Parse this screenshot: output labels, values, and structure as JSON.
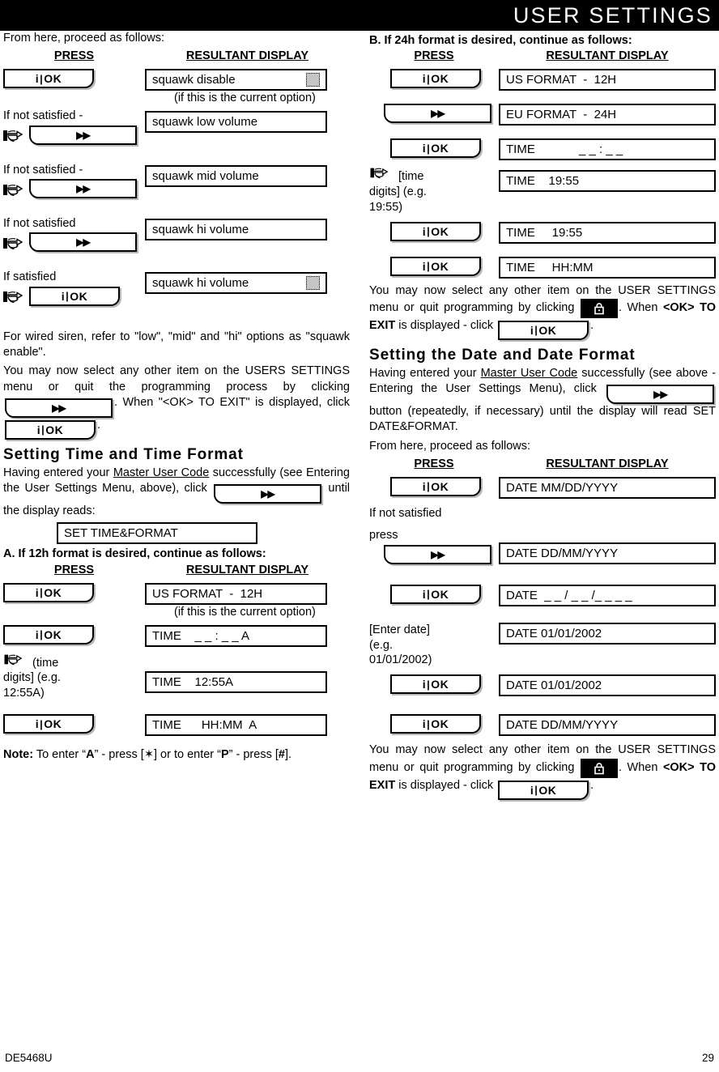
{
  "banner": {
    "title": "USER SETTINGS"
  },
  "keys": {
    "ok_label": "OK",
    "ok_i": "i",
    "ok_sep": "|",
    "next_label": "▶▶",
    "lock_name": "away-arm-lock-button"
  },
  "columns": {
    "press_header": "PRESS",
    "result_header": "RESULTANT DISPLAY"
  },
  "left": {
    "intro": "From here, proceed as follows:",
    "steps": [
      {
        "display": "squawk disable",
        "cursor": true,
        "sub": "(if this is the current option)"
      },
      {
        "label": "If not satisfied -",
        "display": "squawk low volume"
      },
      {
        "label": "If not satisfied -",
        "display": "squawk mid volume"
      },
      {
        "label": "If not satisfied",
        "display": "squawk hi volume"
      },
      {
        "label": "If satisfied",
        "display": "squawk hi volume",
        "cursor": true
      }
    ],
    "para_wired_1": "For wired siren, refer to \"low\", \"mid\" and \"hi\" options",
    "para_wired_2": "as \"squawk enable\".",
    "para_quit_1": "You may now select any other item on the USERS",
    "para_quit_2": "SETTINGS menu or quit the programming process by",
    "para_quit_3a": "clicking",
    "para_quit_3b": ". When \"<OK> TO EXIT\" is",
    "para_quit_4a": "displayed, click",
    "para_quit_4b": ".",
    "heading_time": "Setting Time and Time Format",
    "time_para_1": "Having entered your",
    "time_para_1_link": "Master User Code",
    "time_para_1_end": "successfully",
    "time_para_2": "(see Entering the User Settings Menu, above), click",
    "time_para_3": "until the display reads:",
    "set_time_display": "SET TIME&FORMAT",
    "subhead_a": "A. If 12h format is desired, continue as follows:",
    "steps_a": [
      {
        "display": "US FORMAT  -  12H",
        "sub": "(if this is the current option)"
      },
      {
        "display": "TIME    _ _ : _ _ A"
      },
      {
        "hand": true,
        "label_lines": [
          "(time",
          "digits] (e.g.",
          "12:55A)"
        ],
        "display": "TIME    12:55A"
      },
      {
        "display": "TIME      HH:MM  A"
      }
    ],
    "note_prefix": "Note:",
    "note_text_1": " To enter “",
    "note_a": "A",
    "note_text_2": "” - press [",
    "note_star": "✶",
    "note_text_3": "] or to enter “",
    "note_p": "P",
    "note_text_4": "” - press [",
    "note_hash": "#",
    "note_text_5": "]."
  },
  "right": {
    "subhead_b": "B. If 24h format is desired, continue as follows:",
    "steps_b": [
      {
        "key": "ok",
        "display": "US FORMAT  -  12H"
      },
      {
        "key": "next",
        "display": "EU FORMAT  -  24H"
      },
      {
        "key": "ok",
        "display": "TIME             _ _ : _ _"
      },
      {
        "hand": true,
        "label_lines": [
          "[time",
          "digits] (e.g.",
          "19:55)"
        ],
        "display": "TIME    19:55"
      },
      {
        "key": "ok",
        "display": "TIME     19:55"
      },
      {
        "key": "ok",
        "display": "TIME     HH:MM"
      }
    ],
    "quit_1": "You may now select any other item on the USER",
    "quit_2": "SETTINGS menu or quit programming by clicking",
    "quit_3b": ". When",
    "quit_ok_tag": "<OK>",
    "quit_exit": "TO EXIT",
    "quit_3c": "is displayed - click",
    "quit_4b": ".",
    "heading_date": "Setting the Date and Date Format",
    "date_para_1": "Having entered your",
    "date_para_1_link": "Master User Code",
    "date_para_1_end": "successfully",
    "date_para_2": "(see above - Entering the User Settings Menu),  click",
    "date_para_3": "button (repeatedly, if necessary) until",
    "date_para_4": "the display will read SET DATE&FORMAT.",
    "date_para_5": "From here, proceed as follows:",
    "steps_d": [
      {
        "key": "ok",
        "display": "DATE MM/DD/YYYY"
      },
      {
        "key": "next",
        "label_lines": [
          "If not satisfied",
          "press"
        ],
        "display": "DATE DD/MM/YYYY"
      },
      {
        "key": "ok",
        "display": "DATE  _ _ / _ _ /_ _ _ _"
      },
      {
        "label_lines": [
          "[Enter     date]",
          "(e.g.",
          "01/01/2002)"
        ],
        "display": "DATE 01/01/2002"
      },
      {
        "key": "ok",
        "display": "DATE 01/01/2002"
      },
      {
        "key": "ok",
        "display": "DATE DD/MM/YYYY"
      }
    ]
  },
  "footer": {
    "doc_id": "DE5468U",
    "page_number": "29"
  }
}
